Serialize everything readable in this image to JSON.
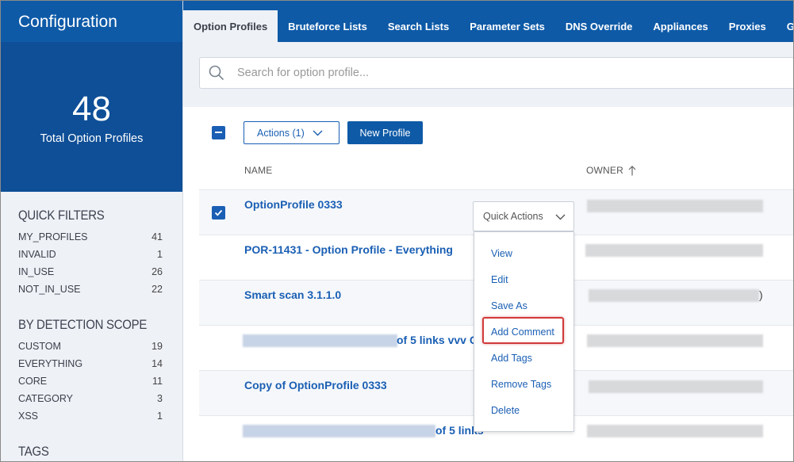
{
  "app": {
    "title": "Configuration"
  },
  "summary": {
    "count": "48",
    "label": "Total Option Profiles"
  },
  "filters": {
    "quick": {
      "title": "QUICK FILTERS",
      "items": [
        {
          "label": "MY_PROFILES",
          "count": "41"
        },
        {
          "label": "INVALID",
          "count": "1"
        },
        {
          "label": "IN_USE",
          "count": "26"
        },
        {
          "label": "NOT_IN_USE",
          "count": "22"
        }
      ]
    },
    "scope": {
      "title": "BY DETECTION SCOPE",
      "items": [
        {
          "label": "CUSTOM",
          "count": "19"
        },
        {
          "label": "EVERYTHING",
          "count": "14"
        },
        {
          "label": "CORE",
          "count": "11"
        },
        {
          "label": "CATEGORY",
          "count": "3"
        },
        {
          "label": "XSS",
          "count": "1"
        }
      ]
    },
    "tags": {
      "title": "TAGS"
    }
  },
  "tabs": [
    {
      "label": "Option Profiles",
      "active": true
    },
    {
      "label": "Bruteforce Lists"
    },
    {
      "label": "Search Lists"
    },
    {
      "label": "Parameter Sets"
    },
    {
      "label": "DNS Override"
    },
    {
      "label": "Appliances"
    },
    {
      "label": "Proxies"
    },
    {
      "label": "G"
    }
  ],
  "search": {
    "placeholder": "Search for option profile..."
  },
  "toolbar": {
    "actions_label": "Actions (1)",
    "new_label": "New Profile"
  },
  "columns": {
    "name": "NAME",
    "owner": "OWNER"
  },
  "rows": [
    {
      "name": "OptionProfile 0333",
      "checked": true
    },
    {
      "name": "POR-11431 - Option Profile - Everything"
    },
    {
      "name": "Smart scan 3.1.1.0",
      "owner_suffix": ")"
    },
    {
      "name_suffix": "of 5 links vvv C"
    },
    {
      "name": "Copy of OptionProfile 0333"
    },
    {
      "name_suffix": "of 5 links"
    }
  ],
  "quick_actions": {
    "label": "Quick Actions",
    "items": [
      "View",
      "Edit",
      "Save As",
      "Add Comment",
      "Add Tags",
      "Remove Tags",
      "Delete"
    ],
    "highlighted": "Add Comment"
  },
  "colors": {
    "brand": "#0e5aa7",
    "brand_dark": "#0e4f97",
    "link": "#1a5fb4",
    "highlight": "#d03a3a"
  }
}
